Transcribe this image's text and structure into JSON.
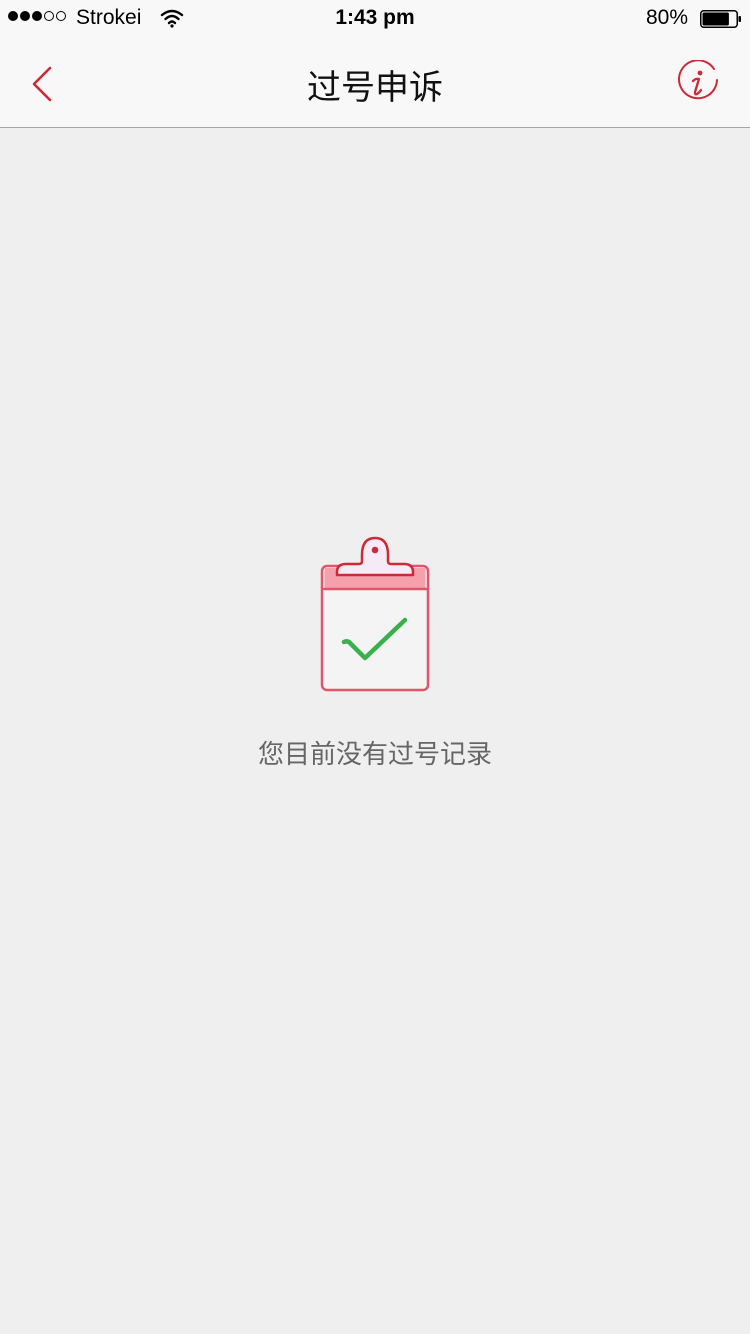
{
  "status_bar": {
    "carrier": "Strokei",
    "time": "1:43 pm",
    "battery_percent": "80%",
    "battery_level": 0.8,
    "signal_bars": 3,
    "signal_bars_total": 5
  },
  "nav": {
    "title": "过号申诉",
    "back_icon": "chevron-left-icon",
    "info_icon": "info-circle-icon"
  },
  "empty_state": {
    "icon": "clipboard-check-icon",
    "message": "您目前没有过号记录"
  },
  "colors": {
    "accent": "#cc2a36",
    "clipboard": "#e0556a",
    "clipboard_fill": "#f5a0ad",
    "check": "#3ab04a",
    "background": "#efefef",
    "bar_background": "#f8f8f8"
  }
}
